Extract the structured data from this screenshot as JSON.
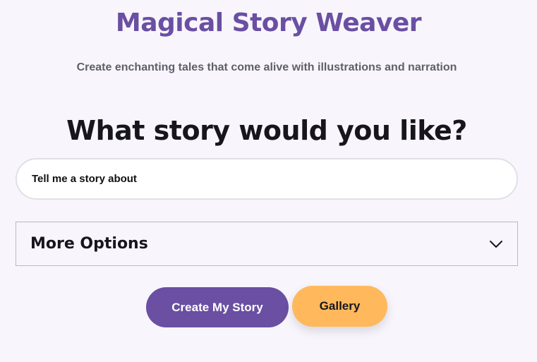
{
  "header": {
    "title": "Magical Story Weaver",
    "subtitle": "Create enchanting tales that come alive with illustrations and narration"
  },
  "prompt": {
    "heading": "What story would you like?",
    "input_value": "",
    "input_placeholder": "Tell me a story about"
  },
  "options": {
    "label": "More Options",
    "icon": "chevron-down-icon",
    "expanded": false
  },
  "actions": {
    "create_label": "Create My Story",
    "gallery_label": "Gallery"
  },
  "colors": {
    "brand_purple": "#6a4fa3",
    "accent_orange": "#ffb85c",
    "background": "#f8f6fc",
    "text_dark": "#16161c",
    "text_muted": "#5f5f6a"
  }
}
